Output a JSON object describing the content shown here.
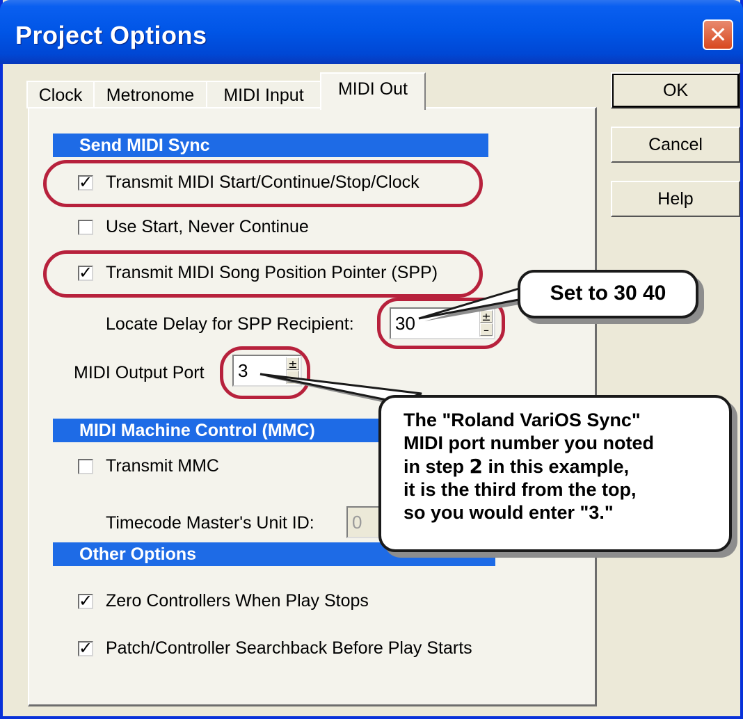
{
  "window": {
    "title": "Project Options"
  },
  "tabs": [
    {
      "label": "Clock",
      "active": false
    },
    {
      "label": "Metronome",
      "active": false
    },
    {
      "label": "MIDI Input",
      "active": false
    },
    {
      "label": "MIDI Out",
      "active": true
    }
  ],
  "buttons": {
    "ok": "OK",
    "cancel": "Cancel",
    "help": "Help"
  },
  "send_midi_sync": {
    "heading": "Send MIDI Sync",
    "transmit_start": {
      "label": "Transmit MIDI Start/Continue/Stop/Clock",
      "checked": true
    },
    "use_start": {
      "label": "Use Start, Never Continue",
      "checked": false
    },
    "transmit_spp": {
      "label": "Transmit MIDI Song Position Pointer (SPP)",
      "checked": true
    },
    "locate_delay": {
      "label": "Locate Delay for SPP Recipient:",
      "value": "30"
    },
    "output_port": {
      "label": "MIDI Output Port",
      "value": "3"
    }
  },
  "mmc": {
    "heading": "MIDI Machine Control (MMC)",
    "transmit_mmc": {
      "label": "Transmit MMC",
      "checked": false
    },
    "unit_id": {
      "label": "Timecode Master's Unit ID:",
      "value": "0"
    }
  },
  "other": {
    "heading": "Other Options",
    "zero_controllers": {
      "label": "Zero Controllers When Play Stops",
      "checked": true
    },
    "searchback": {
      "label": "Patch/Controller Searchback Before Play Starts",
      "checked": true
    }
  },
  "callouts": {
    "set_to": "Set to 30  40",
    "port_line1": "The \"Roland VariOS Sync\"",
    "port_line2": "MIDI port number you noted",
    "port_line3_pre": "in step ",
    "port_line3_num": "2",
    "port_line3_post": " in this example,",
    "port_line4": "it is the third from the top,",
    "port_line5": "so you would enter \"3.\""
  },
  "colors": {
    "title_bar": "#0055e6",
    "section_heading": "#1e6be6",
    "highlight": "#b7213c",
    "close_button": "#d8481f"
  },
  "icons": {
    "close": "close-x-icon",
    "checkbox_mark": "checkmark-icon",
    "spin_up": "spin-up-icon",
    "spin_down": "spin-down-icon"
  }
}
